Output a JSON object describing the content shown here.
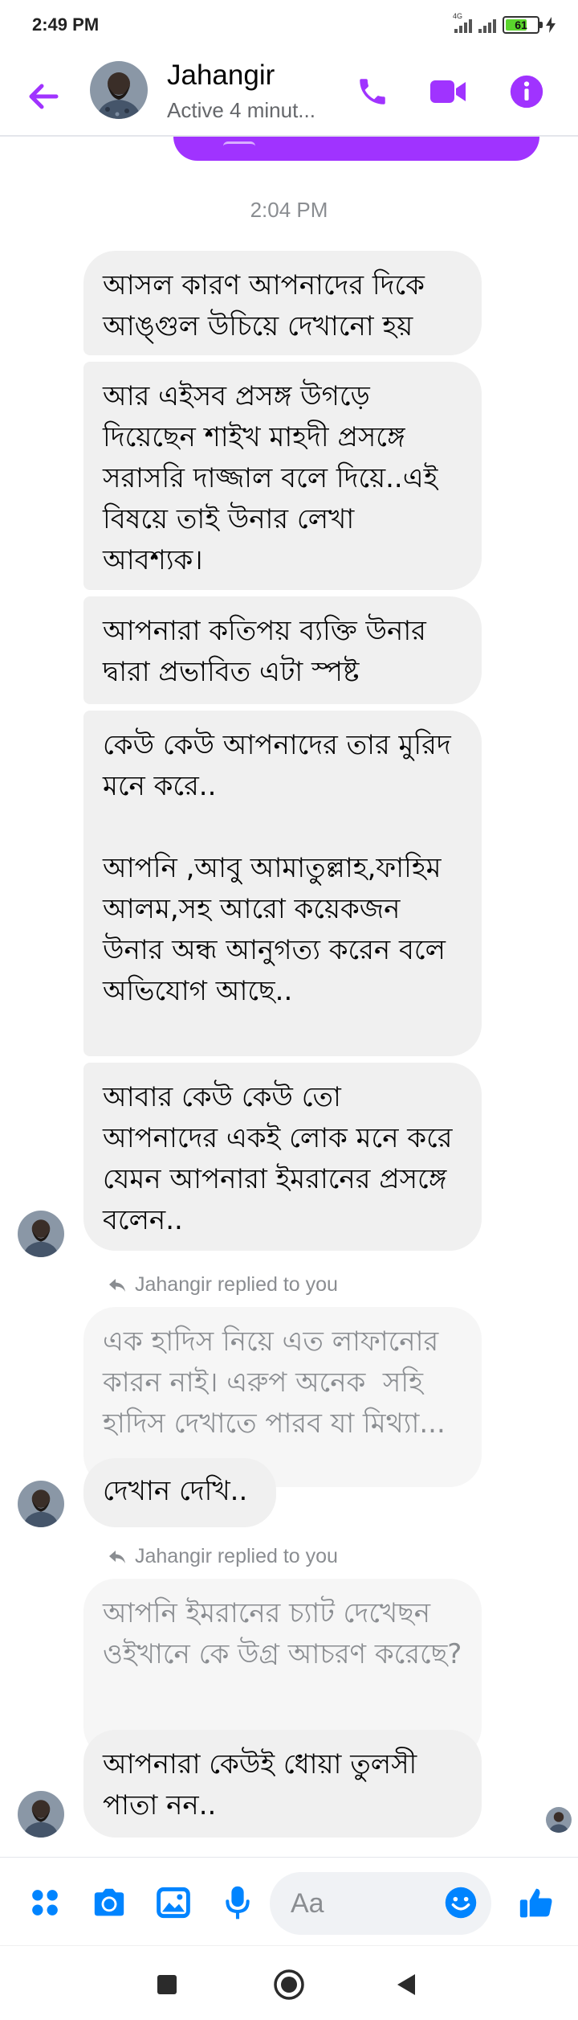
{
  "status_bar": {
    "time": "2:49 PM",
    "network": "4G",
    "battery": "61"
  },
  "header": {
    "name": "Jahangir",
    "status": "Active 4 minut..."
  },
  "chat": {
    "time_separator": "2:04 PM",
    "group1": [
      "আসল কারণ আপনাদের দিকে আঙ্গুল উচিয়ে দেখানো হয়",
      "আর এইসব প্রসঙ্গ উগড়ে দিয়েছেন শাইখ মাহদী প্রসঙ্গে সরাসরি দাজ্জাল বলে দিয়ে..এই বিষয়ে তাই উনার লেখা আবশ্যক।",
      "আপনারা কতিপয় ব্যক্তি উনার দ্বারা প্রভাবিত এটা স্পষ্ট",
      "কেউ কেউ আপনাদের তার মুরিদ মনে করে..\n\nআপনি ,আবু আমাতুল্লাহ,ফাহিম আলম,সহ আরো কয়েকজন উনার অন্ধ আনুগত্য করেন বলে অভিযোগ আছে..",
      "আবার কেউ কেউ তো আপনাদের একই লোক মনে করে যেমন আপনারা ইমরানের প্রসঙ্গে বলেন.."
    ],
    "reply1": {
      "label": "Jahangir replied to you",
      "quoted": "এক হাদিস নিয়ে এত লাফানোর কারন নাই। এরুপ অনেক  সহি হাদিস দেখাতে পারব যা মিথ্যা...",
      "message": "দেখান দেখি.."
    },
    "reply2": {
      "label": "Jahangir replied to you",
      "quoted": "আপনি ইমরানের চ্যাট দেখেছন ওইখানে কে উগ্র আচরণ করেছে?",
      "message": "আপনারা কেউই ধোয়া তুলসী পাতা নন.."
    }
  },
  "composer": {
    "placeholder": "Aa"
  },
  "colors": {
    "accent": "#a033ff",
    "blue": "#0084ff",
    "bubble": "#f0f0f0"
  },
  "icons": [
    "back-arrow-icon",
    "phone-icon",
    "video-icon",
    "info-icon",
    "apps-icon",
    "camera-icon",
    "gallery-icon",
    "mic-icon",
    "emoji-icon",
    "thumbs-up-icon",
    "recents-icon",
    "home-icon",
    "back-icon"
  ]
}
